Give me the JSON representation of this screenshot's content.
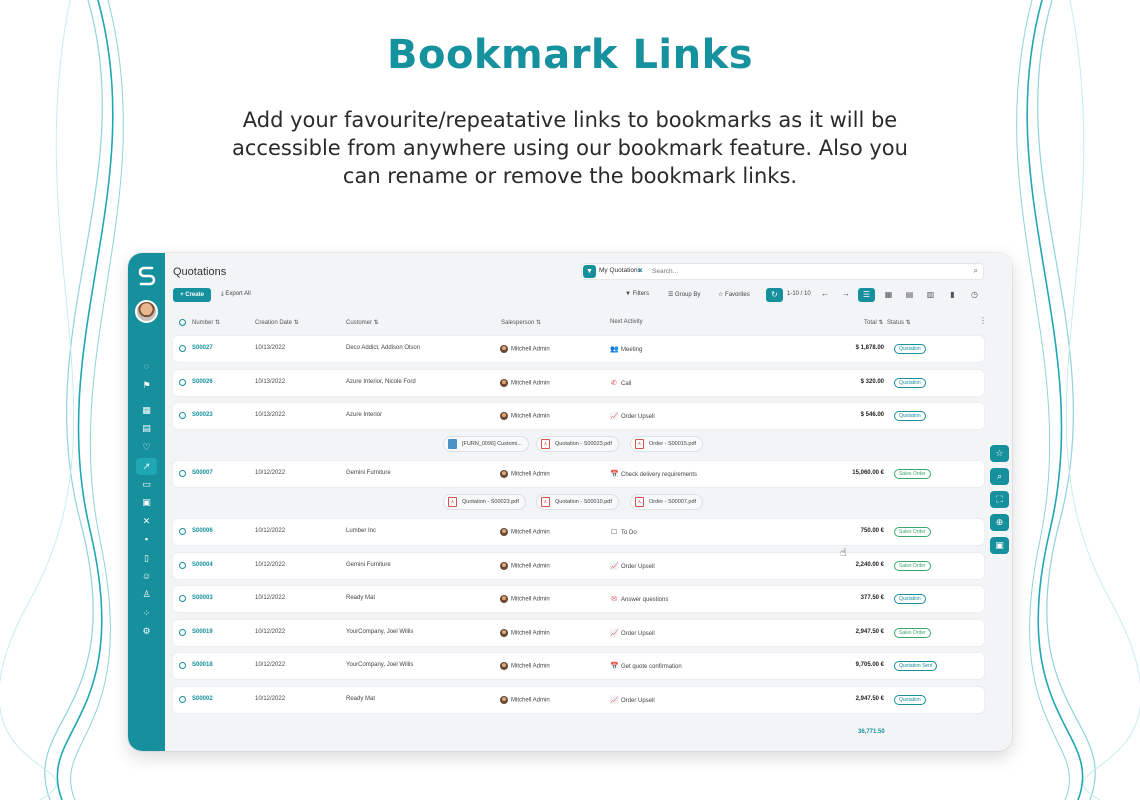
{
  "hero": {
    "title": "Bookmark Links",
    "description": "Add your favourite/repeatative links to bookmarks as it will be accessible from anywhere using our bookmark feature. Also you can rename or remove the bookmark links."
  },
  "app": {
    "page_title": "Quotations",
    "search": {
      "facet": "My Quotations",
      "placeholder": "Search..."
    },
    "toolbar": {
      "create_label": "+ Create",
      "export_label": "Export All",
      "filters_label": "Filters",
      "groupby_label": "Group By",
      "favorites_label": "Favorites",
      "pager": "1-10 / 10"
    },
    "columns": {
      "number": "Number",
      "creation_date": "Creation Date",
      "customer": "Customer",
      "salesperson": "Salesperson",
      "next_activity": "Next Activity",
      "total": "Total",
      "status": "Status"
    },
    "rows": [
      {
        "number": "S00027",
        "date": "10/13/2022",
        "customer": "Deco Addict, Addison Olson",
        "salesperson": "Mitchell Admin",
        "activity": "Meeting",
        "activity_icon": "meeting-icon",
        "total": "$ 1,878.00",
        "status": "Quotation"
      },
      {
        "number": "S00026",
        "date": "10/13/2022",
        "customer": "Azure Interior, Nicole Ford",
        "salesperson": "Mitchell Admin",
        "activity": "Call",
        "activity_icon": "phone-icon",
        "total": "$ 320.00",
        "status": "Quotation"
      },
      {
        "number": "S00023",
        "date": "10/13/2022",
        "customer": "Azure Interior",
        "salesperson": "Mitchell Admin",
        "activity": "Order Upsell",
        "activity_icon": "chart-icon",
        "total": "$ 546.00",
        "status": "Quotation"
      },
      {
        "number": "S00007",
        "date": "10/12/2022",
        "customer": "Gemini Furniture",
        "salesperson": "Mitchell Admin",
        "activity": "Check delivery requirements",
        "activity_icon": "calendar-icon",
        "total": "15,060.00 €",
        "status": "Sales Order"
      },
      {
        "number": "S00006",
        "date": "10/12/2022",
        "customer": "Lumber Inc",
        "salesperson": "Mitchell Admin",
        "activity": "To Do",
        "activity_icon": "todo-icon",
        "total": "750.00 €",
        "status": "Sales Order"
      },
      {
        "number": "S00004",
        "date": "10/12/2022",
        "customer": "Gemini Furniture",
        "salesperson": "Mitchell Admin",
        "activity": "Order Upsell",
        "activity_icon": "chart-icon",
        "total": "2,240.00 €",
        "status": "Sales Order"
      },
      {
        "number": "S00003",
        "date": "10/12/2022",
        "customer": "Ready Mat",
        "salesperson": "Mitchell Admin",
        "activity": "Answer questions",
        "activity_icon": "mail-icon",
        "total": "377.50 €",
        "status": "Quotation"
      },
      {
        "number": "S00019",
        "date": "10/12/2022",
        "customer": "YourCompany, Joel Willis",
        "salesperson": "Mitchell Admin",
        "activity": "Order Upsell",
        "activity_icon": "chart-icon",
        "total": "2,947.50 €",
        "status": "Sales Order"
      },
      {
        "number": "S00018",
        "date": "10/12/2022",
        "customer": "YourCompany, Joel Willis",
        "salesperson": "Mitchell Admin",
        "activity": "Get quote confirmation",
        "activity_icon": "calendar-icon",
        "total": "9,705.00 €",
        "status": "Quotation Sent"
      },
      {
        "number": "S00002",
        "date": "10/12/2022",
        "customer": "Ready Mat",
        "salesperson": "Mitchell Admin",
        "activity": "Order Upsell",
        "activity_icon": "chart-icon",
        "total": "2,947.50 €",
        "status": "Quotation"
      }
    ],
    "attachments_1": [
      {
        "name": "[FURN_0096] Customi...",
        "icon": "image-icon"
      },
      {
        "name": "Quotation - S00023.pdf",
        "icon": "pdf-icon"
      },
      {
        "name": "Order - S00015.pdf",
        "icon": "pdf-icon"
      }
    ],
    "attachments_2": [
      {
        "name": "Quotation - S00023.pdf",
        "icon": "pdf-icon"
      },
      {
        "name": "Quotation - S00010.pdf",
        "icon": "pdf-icon"
      },
      {
        "name": "Order - S00007.pdf",
        "icon": "pdf-icon"
      }
    ],
    "grand_total": "36,771.50"
  },
  "colors": {
    "accent": "#15909c",
    "hero_title": "#16919e",
    "sales_order_badge": "#3aa86b"
  }
}
